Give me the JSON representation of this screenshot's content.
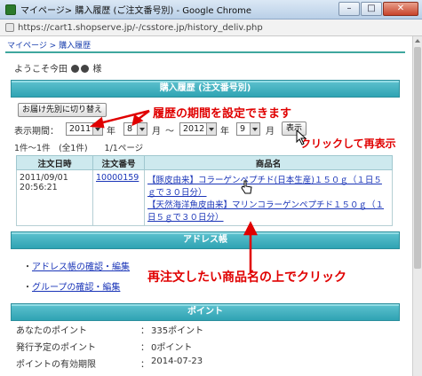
{
  "window": {
    "title": "マイページ> 購入履歴 (ご注文番号別) - Google Chrome",
    "min": "–",
    "max": "□",
    "close": "✕"
  },
  "address": {
    "url": "https://cart1.shopserve.jp/-/csstore.jp/history_deliv.php"
  },
  "page": {
    "breadcrumb": "マイページ > 購入履歴",
    "welcome_prefix": "ようこそ今田",
    "welcome_suffix": "様"
  },
  "history": {
    "header": "購入履歴 (注文番号別)",
    "switch_button": "お届け先別に切り替え",
    "period_label": "表示期間：",
    "from_year": "2011",
    "year_unit": "年",
    "from_month": "8",
    "month_unit": "月",
    "tilde": "～",
    "to_year": "2012",
    "to_month": "9",
    "show_button": "表示",
    "summary": "1件～1件　(全1件)　　1/1ページ",
    "columns": [
      "注文日時",
      "注文番号",
      "商品名"
    ],
    "rows": [
      {
        "date": "2011/09/01",
        "time": "20:56:21",
        "order_no": "10000159",
        "items": [
          "【豚皮由来】コラーゲンペプチド(日本生産)１５０ｇ（１日５ｇで３０日分）",
          "【天然海洋魚皮由来】マリンコラーゲンペプチド１５０ｇ（１日５ｇで３０日分）"
        ]
      }
    ]
  },
  "address_book": {
    "header": "アドレス帳",
    "links": [
      "アドレス帳の確認・編集",
      "グループの確認・編集"
    ]
  },
  "points": {
    "header": "ポイント",
    "rows": [
      {
        "label": "あなたのポイント",
        "value": "335ポイント"
      },
      {
        "label": "発行予定のポイント",
        "value": "0ポイント"
      },
      {
        "label": "ポイントの有効期限",
        "value": "2014-07-23"
      }
    ]
  },
  "annotations": {
    "period": "履歴の期間を設定できます",
    "redisplay": "クリックして再表示",
    "reorder": "再注文したい商品名の上でクリック"
  },
  "colors": {
    "section_bar": "#2fa3b3",
    "annotation": "#e00000",
    "link": "#1a35b8"
  }
}
